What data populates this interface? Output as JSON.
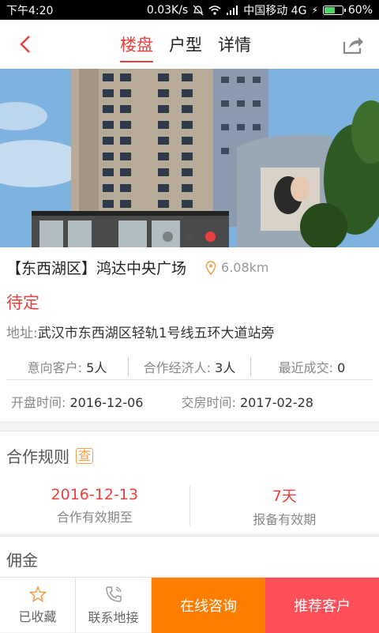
{
  "statusbar": {
    "time": "下午4:20",
    "speed": "0.03K/s",
    "carrier": "中国移动 4G",
    "battery": "60%"
  },
  "nav": {
    "tabs": [
      "楼盘",
      "户型",
      "详情"
    ],
    "active_tab": 0
  },
  "gallery": {
    "dot_count": 3,
    "active_dot": 2
  },
  "property": {
    "title": "【东西湖区】鸿达中央广场",
    "distance": "6.08km",
    "price": "待定",
    "address_label": "地址:",
    "address": "武汉市东西湖区轻轨1号线五环大道站旁",
    "stats": [
      {
        "label": "意向客户:",
        "value": "5人"
      },
      {
        "label": "合作经济人:",
        "value": "3人"
      },
      {
        "label": "最近成交:",
        "value": "0"
      }
    ],
    "open_label": "开盘时间:",
    "open_date": "2016-12-06",
    "delivery_label": "交房时间:",
    "delivery_date": "2017-02-28"
  },
  "rules": {
    "title": "合作规则",
    "badge": "查",
    "items": [
      {
        "value": "2016-12-13",
        "label": "合作有效期至"
      },
      {
        "value": "7天",
        "label": "报备有效期"
      }
    ]
  },
  "commission": {
    "title": "佣金"
  },
  "bottombar": {
    "favorite": "已收藏",
    "contact": "联系地接",
    "consult": "在线咨询",
    "recommend": "推荐客户"
  },
  "colors": {
    "accent": "#e8413f",
    "orange": "#ff7e00",
    "recommend": "#ff4f58"
  }
}
